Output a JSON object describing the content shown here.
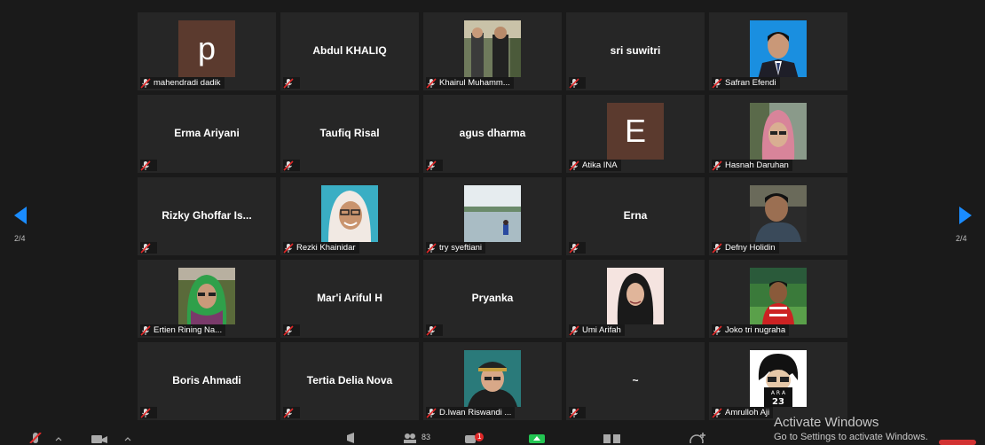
{
  "pagination": {
    "left": "2/4",
    "right": "2/4"
  },
  "participants": [
    {
      "name": "mahendradi dadik",
      "label": "mahendradi dadik",
      "kind": "avatar",
      "initial": "p"
    },
    {
      "name": "Abdul KHALIQ",
      "label": "",
      "kind": "name"
    },
    {
      "name": "Khairul Muhammad",
      "label": "Khairul Muhamm...",
      "kind": "photo",
      "photo": "group"
    },
    {
      "name": "sri suwitri",
      "label": "",
      "kind": "name"
    },
    {
      "name": "Safran Efendi",
      "label": "Safran Efendi",
      "kind": "photo",
      "photo": "suit"
    },
    {
      "name": "Erma Ariyani",
      "label": "",
      "kind": "name"
    },
    {
      "name": "Taufiq Risal",
      "label": "",
      "kind": "name"
    },
    {
      "name": "agus dharma",
      "label": "",
      "kind": "name"
    },
    {
      "name": "Atika INA",
      "label": "Atika INA",
      "kind": "avatar",
      "initial": "E"
    },
    {
      "name": "Hasnah Daruhan",
      "label": "Hasnah Daruhan",
      "kind": "photo",
      "photo": "hijab-pink"
    },
    {
      "name": "Rizky Ghoffar Is...",
      "label": "",
      "kind": "name"
    },
    {
      "name": "Rezki Khainidar",
      "label": "Rezki Khainidar",
      "kind": "photo",
      "photo": "hijab-white"
    },
    {
      "name": "try syeftiani",
      "label": "try syeftiani",
      "kind": "photo",
      "photo": "sea"
    },
    {
      "name": "Erna",
      "label": "",
      "kind": "name"
    },
    {
      "name": "Defny Holidin",
      "label": "Defny Holidin",
      "kind": "photo",
      "photo": "man-dark"
    },
    {
      "name": "Ertien Rining Na...",
      "label": "Ertien Rining Na...",
      "kind": "photo",
      "photo": "hijab-green"
    },
    {
      "name": "Mar'i Ariful H",
      "label": "",
      "kind": "name"
    },
    {
      "name": "Pryanka",
      "label": "",
      "kind": "name"
    },
    {
      "name": "Umi Arifah",
      "label": "Umi Arifah",
      "kind": "photo",
      "photo": "hijab-black"
    },
    {
      "name": "Joko tri nugraha",
      "label": "Joko tri nugraha",
      "kind": "photo",
      "photo": "man-red"
    },
    {
      "name": "Boris Ahmadi",
      "label": "",
      "kind": "name"
    },
    {
      "name": "Tertia Delia Nova",
      "label": "",
      "kind": "name"
    },
    {
      "name": "D.Iwan Riswandi",
      "label": "D.Iwan Riswandi ...",
      "kind": "photo",
      "photo": "man-hat"
    },
    {
      "name": "~",
      "label": "",
      "kind": "name"
    },
    {
      "name": "Amrulloh Aji",
      "label": "Amrulloh Aji",
      "kind": "photo",
      "photo": "cartoon",
      "photo_text": "A R A",
      "photo_number": "23"
    }
  ],
  "watermark": {
    "title": "Activate Windows",
    "subtitle": "Go to Settings to activate Windows."
  },
  "toolbar": {
    "participants_count": "83",
    "chat_badge": "1"
  },
  "colors": {
    "tile_bg": "#262626",
    "page_bg": "#1a1a1a",
    "accent_blue": "#1a8cff",
    "mute_red": "#e02828",
    "avatar_bg": "#5b3a2e"
  }
}
